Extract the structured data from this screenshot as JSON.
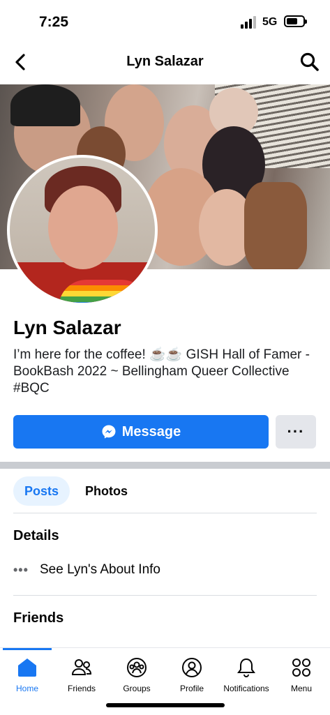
{
  "status": {
    "time": "7:25",
    "network": "5G"
  },
  "header": {
    "title": "Lyn Salazar",
    "back_icon": "chevron-left-icon",
    "search_icon": "search-icon"
  },
  "profile": {
    "name": "Lyn Salazar",
    "bio": "I’m here for the coffee! ☕️☕️ GISH Hall of Famer - BookBash 2022 ~ Bellingham Queer Collective #BQC"
  },
  "actions": {
    "message_label": "Message",
    "more_label": "···"
  },
  "tabs": [
    {
      "label": "Posts",
      "active": true
    },
    {
      "label": "Photos",
      "active": false
    }
  ],
  "details": {
    "heading": "Details",
    "about_label": "See Lyn's About Info"
  },
  "friends": {
    "heading": "Friends"
  },
  "tabbar": [
    {
      "label": "Home",
      "icon": "home-icon",
      "active": true
    },
    {
      "label": "Friends",
      "icon": "friends-icon",
      "active": false
    },
    {
      "label": "Groups",
      "icon": "groups-icon",
      "active": false
    },
    {
      "label": "Profile",
      "icon": "profile-icon",
      "active": false
    },
    {
      "label": "Notifications",
      "icon": "bell-icon",
      "active": false
    },
    {
      "label": "Menu",
      "icon": "menu-grid-icon",
      "active": false
    }
  ],
  "colors": {
    "accent": "#1877f2",
    "secondary_button": "#e4e6eb",
    "active_tab_bg": "#e7f3ff"
  }
}
